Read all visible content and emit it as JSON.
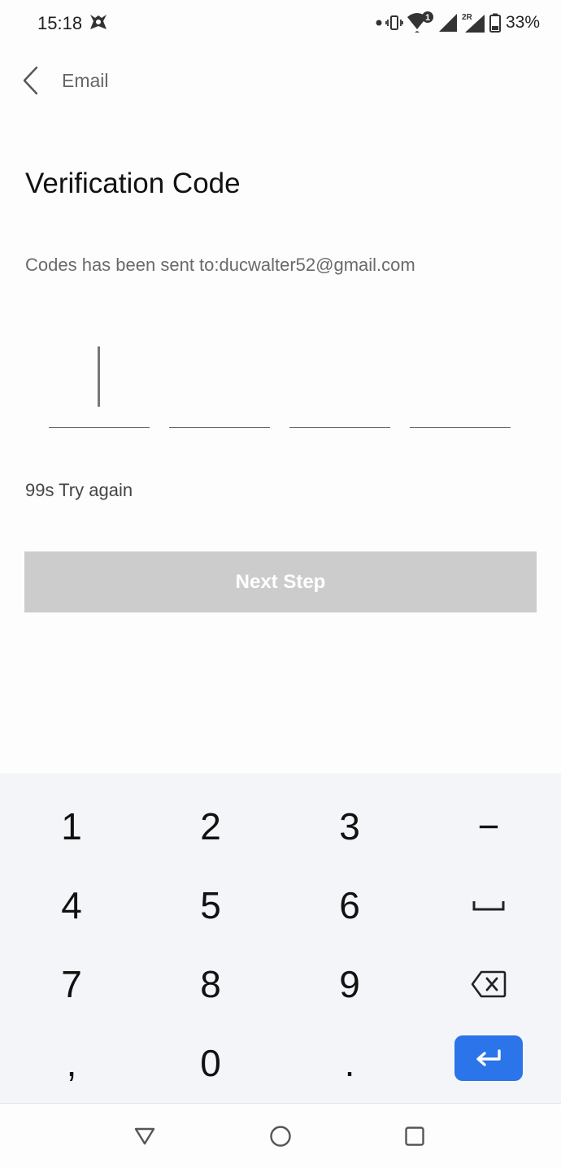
{
  "status_bar": {
    "time": "15:18",
    "battery_percent": "33%",
    "sim_badge": "1",
    "roaming_label": "2R",
    "icons": [
      "app-notification-icon",
      "dot-icon",
      "vibrate-icon",
      "wifi-icon",
      "signal-icon",
      "signal-roaming-icon",
      "battery-icon"
    ]
  },
  "header": {
    "title": "Email",
    "back_icon": "chevron-left-icon"
  },
  "main": {
    "title": "Verification Code",
    "sent_text": "Codes has been sent to:ducwalter52@gmail.com",
    "code_boxes": [
      "",
      "",
      "",
      ""
    ],
    "retry_text": "99s Try again",
    "next_button_label": "Next Step",
    "next_button_color": "#cccccc"
  },
  "keyboard": {
    "rows": [
      [
        "1",
        "2",
        "3",
        "−"
      ],
      [
        "4",
        "5",
        "6",
        "space"
      ],
      [
        "7",
        "8",
        "9",
        "backspace"
      ],
      [
        ",",
        "0",
        ".",
        "enter"
      ]
    ],
    "enter_color": "#2b74e9"
  },
  "nav_bar": {
    "icons": [
      "back-triangle-icon",
      "home-circle-icon",
      "recents-square-icon"
    ]
  }
}
